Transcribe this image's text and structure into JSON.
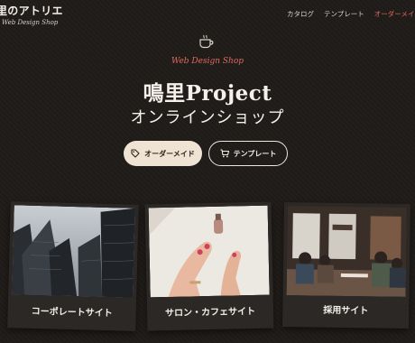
{
  "header": {
    "logo_title": "里のアトリエ",
    "logo_subtitle": "Web Design Shop",
    "nav": [
      {
        "label": "カタログ",
        "active": false
      },
      {
        "label": "テンプレート",
        "active": false
      },
      {
        "label": "オーダーメイ",
        "active": true
      }
    ]
  },
  "hero": {
    "icon": "coffee-cup-icon",
    "tagline": "Web Design Shop",
    "title_line1": "鳴里Project",
    "title_line2": "オンラインショップ",
    "primary_button": {
      "label": "オーダーメイド",
      "icon": "tag-icon"
    },
    "secondary_button": {
      "label": "テンプレート",
      "icon": "cart-icon"
    }
  },
  "cards": [
    {
      "label": "コーポレートサイト",
      "image": "office-buildings-photo"
    },
    {
      "label": "サロン・カフェサイト",
      "image": "manicure-hands-photo"
    },
    {
      "label": "採用サイト",
      "image": "team-meeting-photo"
    }
  ],
  "colors": {
    "background": "#1f1b19",
    "accent": "#e0685e",
    "primary_button_bg": "#efe4d4",
    "card_bg": "#2b2826"
  }
}
